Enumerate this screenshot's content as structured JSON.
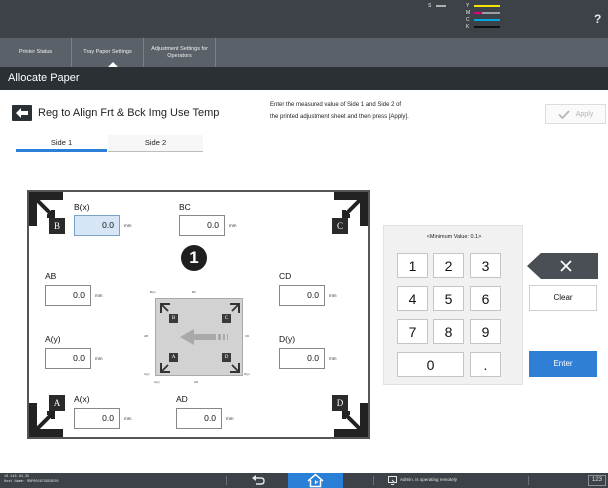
{
  "toner": {
    "levels": [
      {
        "letter": "S",
        "fill": 0.35,
        "color": "#b0b0b0"
      },
      {
        "letter": "Y",
        "fill": 0.9,
        "color": "#f4e300"
      },
      {
        "letter": "M",
        "fill": 0.25,
        "color": "#e0007a"
      },
      {
        "letter": "C",
        "fill": 0.9,
        "color": "#00a7e0"
      },
      {
        "letter": "K",
        "fill": 0.85,
        "color": "#111111"
      }
    ]
  },
  "help": {
    "label": "?"
  },
  "tabs": [
    {
      "label": "Printer Status"
    },
    {
      "label": "Tray Paper Settings"
    },
    {
      "label": "Adjustment Settings for Operators"
    }
  ],
  "section": {
    "title": "Allocate Paper"
  },
  "page": {
    "title": "Reg to Align Frt & Bck Img Use Temp",
    "instruction_line1": "Enter the measured value of Side 1 and Side 2 of",
    "instruction_line2": "the printed adjustment sheet and then press [Apply].",
    "apply_label": "Apply"
  },
  "side_tabs": [
    {
      "label": "Side 1",
      "selected": true
    },
    {
      "label": "Side 2",
      "selected": false
    }
  ],
  "sheet": {
    "corners": [
      "B",
      "C",
      "A",
      "D"
    ],
    "badge": "1",
    "unit": "mm",
    "fields": {
      "bx": {
        "label": "B(x)",
        "value": "0.0"
      },
      "bc": {
        "label": "BC",
        "value": "0.0"
      },
      "ab": {
        "label": "AB",
        "value": "0.0"
      },
      "cd": {
        "label": "CD",
        "value": "0.0"
      },
      "ay": {
        "label": "A(y)",
        "value": "0.0"
      },
      "dy": {
        "label": "D(y)",
        "value": "0.0"
      },
      "ax": {
        "label": "A(x)",
        "value": "0.0"
      },
      "ad": {
        "label": "AD",
        "value": "0.0"
      }
    },
    "mini": {
      "bx": "B(x)",
      "bc": "BC",
      "ab": "AB",
      "cd": "CD",
      "ay": "A(y)",
      "dy": "D(y)",
      "ax": "A(x)",
      "ad": "AD",
      "corners": [
        "B",
        "C",
        "A",
        "D"
      ]
    }
  },
  "keypad": {
    "min_value": "<Minimum Value: 0.1>",
    "keys": [
      "1",
      "2",
      "3",
      "4",
      "5",
      "6",
      "7",
      "8",
      "9",
      "0",
      "."
    ],
    "clear_label": "Clear",
    "enter_label": "Enter"
  },
  "bottom": {
    "ip": "10.146.84.35",
    "host": "Host Name: RNP0026759E9E05",
    "remote_status": "Admin. is operating remotely",
    "counter": "123"
  },
  "colors": {
    "accent": "#2f7fd6",
    "header_dark": "#2b3035",
    "bar_dark": "#3d4248"
  }
}
